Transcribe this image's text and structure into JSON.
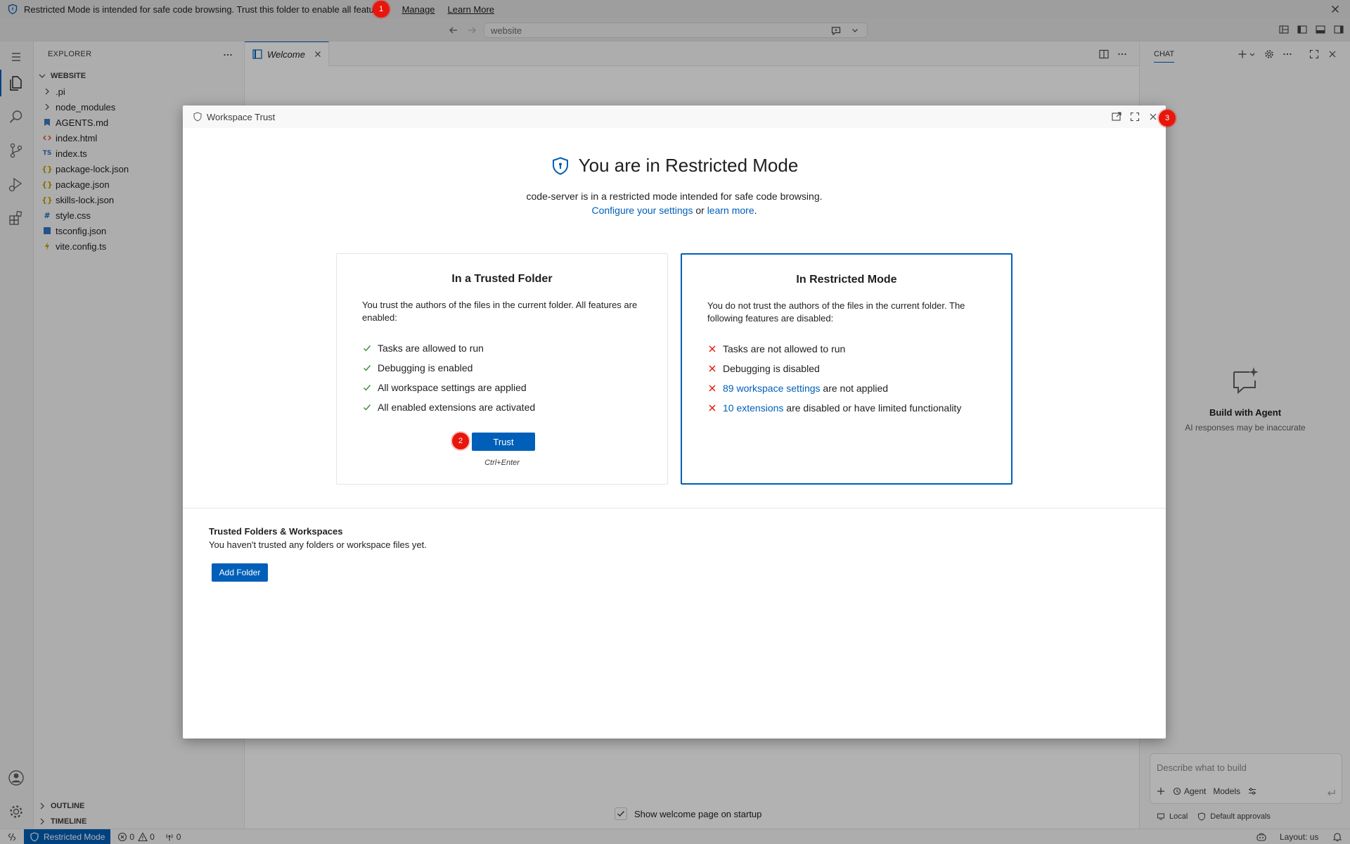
{
  "banner": {
    "text": "Restricted Mode is intended for safe code browsing. Trust this folder to enable all features.",
    "manage_label": "Manage",
    "learn_more_label": "Learn More"
  },
  "titlebar": {
    "command_center_text": "website"
  },
  "explorer": {
    "title": "EXPLORER",
    "folder_name": "WEBSITE",
    "items": [
      {
        "label": ".pi",
        "type": "folder",
        "icon": "chevron-right-icon",
        "color": "#424242"
      },
      {
        "label": "node_modules",
        "type": "folder",
        "icon": "chevron-right-icon",
        "color": "#424242"
      },
      {
        "label": "AGENTS.md",
        "type": "file",
        "icon": "markdown-icon",
        "color": "#3b7dbf"
      },
      {
        "label": "index.html",
        "type": "file",
        "icon": "html-icon",
        "color": "#e44d26"
      },
      {
        "label": "index.ts",
        "type": "file",
        "icon": "typescript-icon",
        "color": "#3178c6"
      },
      {
        "label": "package-lock.json",
        "type": "file",
        "icon": "json-icon",
        "color": "#c5a100"
      },
      {
        "label": "package.json",
        "type": "file",
        "icon": "json-icon",
        "color": "#c5a100"
      },
      {
        "label": "skills-lock.json",
        "type": "file",
        "icon": "json-icon",
        "color": "#c5a100"
      },
      {
        "label": "style.css",
        "type": "file",
        "icon": "css-icon",
        "color": "#1572b6"
      },
      {
        "label": "tsconfig.json",
        "type": "file",
        "icon": "tsconfig-icon",
        "color": "#3178c6"
      },
      {
        "label": "vite.config.ts",
        "type": "file",
        "icon": "vite-icon",
        "color": "#c5a100"
      }
    ],
    "outline_label": "OUTLINE",
    "timeline_label": "TIMELINE"
  },
  "editor": {
    "tab_label": "Welcome",
    "show_welcome_label": "Show welcome page on startup"
  },
  "chat": {
    "title": "CHAT",
    "empty_heading": "Build with Agent",
    "empty_sub": "AI responses may be inaccurate",
    "input_placeholder": "Describe what to build",
    "agent_label": "Agent",
    "models_label": "Models",
    "local_label": "Local",
    "approvals_label": "Default approvals"
  },
  "dialog": {
    "header_title": "Workspace Trust",
    "heading": "You are in Restricted Mode",
    "subtitle": "code-server is in a restricted mode intended for safe code browsing.",
    "configure_link": "Configure your settings",
    "or_text": "or",
    "learn_more_link": "learn more",
    "period": ".",
    "trusted_card": {
      "title": "In a Trusted Folder",
      "description": "You trust the authors of the files in the current folder. All features are enabled:",
      "items": [
        "Tasks are allowed to run",
        "Debugging is enabled",
        "All workspace settings are applied",
        "All enabled extensions are activated"
      ],
      "button_label": "Trust",
      "shortcut": "Ctrl+Enter"
    },
    "restricted_card": {
      "title": "In Restricted Mode",
      "description": "You do not trust the authors of the files in the current folder. The following features are disabled:",
      "item1": "Tasks are not allowed to run",
      "item2": "Debugging is disabled",
      "item3_link": "89 workspace settings",
      "item3_rest": " are not applied",
      "item4_link": "10 extensions",
      "item4_rest": " are disabled or have limited functionality"
    },
    "trusted_folders_title": "Trusted Folders & Workspaces",
    "trusted_folders_sub": "You haven't trusted any folders or workspace files yet.",
    "add_folder_label": "Add Folder"
  },
  "statusbar": {
    "restricted_label": "Restricted Mode",
    "errors": "0",
    "warnings": "0",
    "ports": "0",
    "layout_label": "Layout: us"
  },
  "markers": [
    "1",
    "2",
    "3"
  ],
  "colors": {
    "accent": "#005fb8",
    "check": "#388a34",
    "cross": "#e51400",
    "marker": "#e8160c"
  }
}
